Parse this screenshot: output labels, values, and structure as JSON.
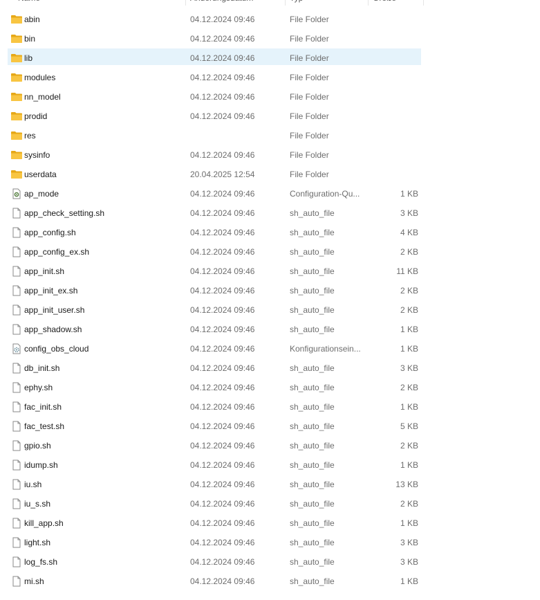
{
  "columns": {
    "name": "Name",
    "date": "Änderungsdatum",
    "type": "Typ",
    "size": "Größe"
  },
  "colors": {
    "folder": "#f8c542",
    "folder_dark": "#e6a817",
    "selected_bg": "#e5f3fb",
    "secondary_text": "#6d6d6d"
  },
  "files": [
    {
      "name": "abin",
      "date": "04.12.2024 09:46",
      "type": "File Folder",
      "size": "",
      "icon": "folder-icon"
    },
    {
      "name": "bin",
      "date": "04.12.2024 09:46",
      "type": "File Folder",
      "size": "",
      "icon": "folder-icon"
    },
    {
      "name": "lib",
      "date": "04.12.2024 09:46",
      "type": "File Folder",
      "size": "",
      "icon": "folder-icon",
      "selected": true
    },
    {
      "name": "modules",
      "date": "04.12.2024 09:46",
      "type": "File Folder",
      "size": "",
      "icon": "folder-icon"
    },
    {
      "name": "nn_model",
      "date": "04.12.2024 09:46",
      "type": "File Folder",
      "size": "",
      "icon": "folder-icon"
    },
    {
      "name": "prodid",
      "date": "04.12.2024 09:46",
      "type": "File Folder",
      "size": "",
      "icon": "folder-icon"
    },
    {
      "name": "res",
      "date": "",
      "type": "File Folder",
      "size": "",
      "icon": "folder-icon"
    },
    {
      "name": "sysinfo",
      "date": "04.12.2024 09:46",
      "type": "File Folder",
      "size": "",
      "icon": "folder-icon"
    },
    {
      "name": "userdata",
      "date": "20.04.2025 12:54",
      "type": "File Folder",
      "size": "",
      "icon": "folder-icon"
    },
    {
      "name": "ap_mode",
      "date": "04.12.2024 09:46",
      "type": "Configuration-Qu...",
      "size": "1 KB",
      "icon": "config-file-icon"
    },
    {
      "name": "app_check_setting.sh",
      "date": "04.12.2024 09:46",
      "type": "sh_auto_file",
      "size": "3 KB",
      "icon": "file-icon"
    },
    {
      "name": "app_config.sh",
      "date": "04.12.2024 09:46",
      "type": "sh_auto_file",
      "size": "4 KB",
      "icon": "file-icon"
    },
    {
      "name": "app_config_ex.sh",
      "date": "04.12.2024 09:46",
      "type": "sh_auto_file",
      "size": "2 KB",
      "icon": "file-icon"
    },
    {
      "name": "app_init.sh",
      "date": "04.12.2024 09:46",
      "type": "sh_auto_file",
      "size": "11 KB",
      "icon": "file-icon"
    },
    {
      "name": "app_init_ex.sh",
      "date": "04.12.2024 09:46",
      "type": "sh_auto_file",
      "size": "2 KB",
      "icon": "file-icon"
    },
    {
      "name": "app_init_user.sh",
      "date": "04.12.2024 09:46",
      "type": "sh_auto_file",
      "size": "2 KB",
      "icon": "file-icon"
    },
    {
      "name": "app_shadow.sh",
      "date": "04.12.2024 09:46",
      "type": "sh_auto_file",
      "size": "1 KB",
      "icon": "file-icon"
    },
    {
      "name": "config_obs_cloud",
      "date": "04.12.2024 09:46",
      "type": "Konfigurationsein...",
      "size": "1 KB",
      "icon": "settings-file-icon"
    },
    {
      "name": "db_init.sh",
      "date": "04.12.2024 09:46",
      "type": "sh_auto_file",
      "size": "3 KB",
      "icon": "file-icon"
    },
    {
      "name": "ephy.sh",
      "date": "04.12.2024 09:46",
      "type": "sh_auto_file",
      "size": "2 KB",
      "icon": "file-icon"
    },
    {
      "name": "fac_init.sh",
      "date": "04.12.2024 09:46",
      "type": "sh_auto_file",
      "size": "1 KB",
      "icon": "file-icon"
    },
    {
      "name": "fac_test.sh",
      "date": "04.12.2024 09:46",
      "type": "sh_auto_file",
      "size": "5 KB",
      "icon": "file-icon"
    },
    {
      "name": "gpio.sh",
      "date": "04.12.2024 09:46",
      "type": "sh_auto_file",
      "size": "2 KB",
      "icon": "file-icon"
    },
    {
      "name": "idump.sh",
      "date": "04.12.2024 09:46",
      "type": "sh_auto_file",
      "size": "1 KB",
      "icon": "file-icon"
    },
    {
      "name": "iu.sh",
      "date": "04.12.2024 09:46",
      "type": "sh_auto_file",
      "size": "13 KB",
      "icon": "file-icon"
    },
    {
      "name": "iu_s.sh",
      "date": "04.12.2024 09:46",
      "type": "sh_auto_file",
      "size": "2 KB",
      "icon": "file-icon"
    },
    {
      "name": "kill_app.sh",
      "date": "04.12.2024 09:46",
      "type": "sh_auto_file",
      "size": "1 KB",
      "icon": "file-icon"
    },
    {
      "name": "light.sh",
      "date": "04.12.2024 09:46",
      "type": "sh_auto_file",
      "size": "3 KB",
      "icon": "file-icon"
    },
    {
      "name": "log_fs.sh",
      "date": "04.12.2024 09:46",
      "type": "sh_auto_file",
      "size": "3 KB",
      "icon": "file-icon"
    },
    {
      "name": "mi.sh",
      "date": "04.12.2024 09:46",
      "type": "sh_auto_file",
      "size": "1 KB",
      "icon": "file-icon"
    }
  ]
}
